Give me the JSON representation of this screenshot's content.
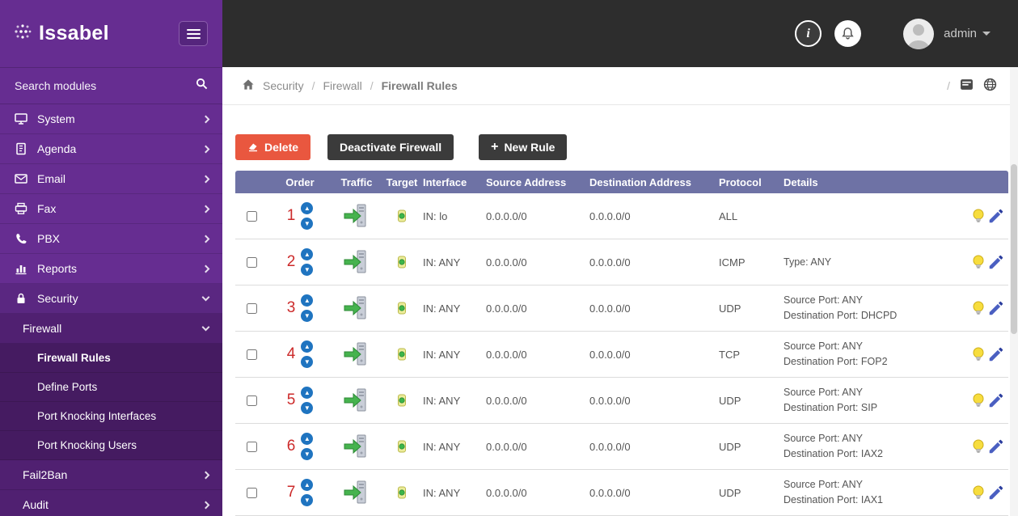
{
  "sidebar": {
    "logo_text": "Issabel",
    "search_placeholder": "Search modules",
    "items": [
      {
        "label": "System"
      },
      {
        "label": "Agenda"
      },
      {
        "label": "Email"
      },
      {
        "label": "Fax"
      },
      {
        "label": "PBX"
      },
      {
        "label": "Reports"
      },
      {
        "label": "Security"
      },
      {
        "label": "Firewall"
      },
      {
        "label": "Firewall Rules"
      },
      {
        "label": "Define Ports"
      },
      {
        "label": "Port Knocking Interfaces"
      },
      {
        "label": "Port Knocking Users"
      },
      {
        "label": "Fail2Ban"
      },
      {
        "label": "Audit"
      }
    ]
  },
  "topbar": {
    "username": "admin"
  },
  "breadcrumb": {
    "items": [
      "Security",
      "Firewall",
      "Firewall Rules"
    ],
    "separator": "/",
    "trailing_separator": "/"
  },
  "toolbar": {
    "delete_label": "Delete",
    "deactivate_label": "Deactivate Firewall",
    "new_rule_plus": "+",
    "new_rule_label": "New Rule"
  },
  "table": {
    "headers": [
      "Order",
      "Traffic",
      "Target",
      "Interface",
      "Source Address",
      "Destination Address",
      "Protocol",
      "Details"
    ],
    "rows": [
      {
        "order": "1",
        "interface": "IN: lo",
        "source": "0.0.0.0/0",
        "destination": "0.0.0.0/0",
        "protocol": "ALL",
        "details": ""
      },
      {
        "order": "2",
        "interface": "IN: ANY",
        "source": "0.0.0.0/0",
        "destination": "0.0.0.0/0",
        "protocol": "ICMP",
        "details": "Type: ANY"
      },
      {
        "order": "3",
        "interface": "IN: ANY",
        "source": "0.0.0.0/0",
        "destination": "0.0.0.0/0",
        "protocol": "UDP",
        "details": "Source Port: ANY\nDestination Port: DHCPD"
      },
      {
        "order": "4",
        "interface": "IN: ANY",
        "source": "0.0.0.0/0",
        "destination": "0.0.0.0/0",
        "protocol": "TCP",
        "details": "Source Port: ANY\nDestination Port: FOP2"
      },
      {
        "order": "5",
        "interface": "IN: ANY",
        "source": "0.0.0.0/0",
        "destination": "0.0.0.0/0",
        "protocol": "UDP",
        "details": "Source Port: ANY\nDestination Port: SIP"
      },
      {
        "order": "6",
        "interface": "IN: ANY",
        "source": "0.0.0.0/0",
        "destination": "0.0.0.0/0",
        "protocol": "UDP",
        "details": "Source Port: ANY\nDestination Port: IAX2"
      },
      {
        "order": "7",
        "interface": "IN: ANY",
        "source": "0.0.0.0/0",
        "destination": "0.0.0.0/0",
        "protocol": "UDP",
        "details": "Source Port: ANY\nDestination Port: IAX1"
      }
    ]
  },
  "colors": {
    "sidebar_purple": "#662d91",
    "topbar_dark": "#2d2d2d",
    "table_header": "#6e72a5",
    "delete_red": "#e9573f",
    "dark_button": "#3b3b3b",
    "order_red": "#cc2a2a",
    "arrow_blue": "#1f74c0"
  }
}
